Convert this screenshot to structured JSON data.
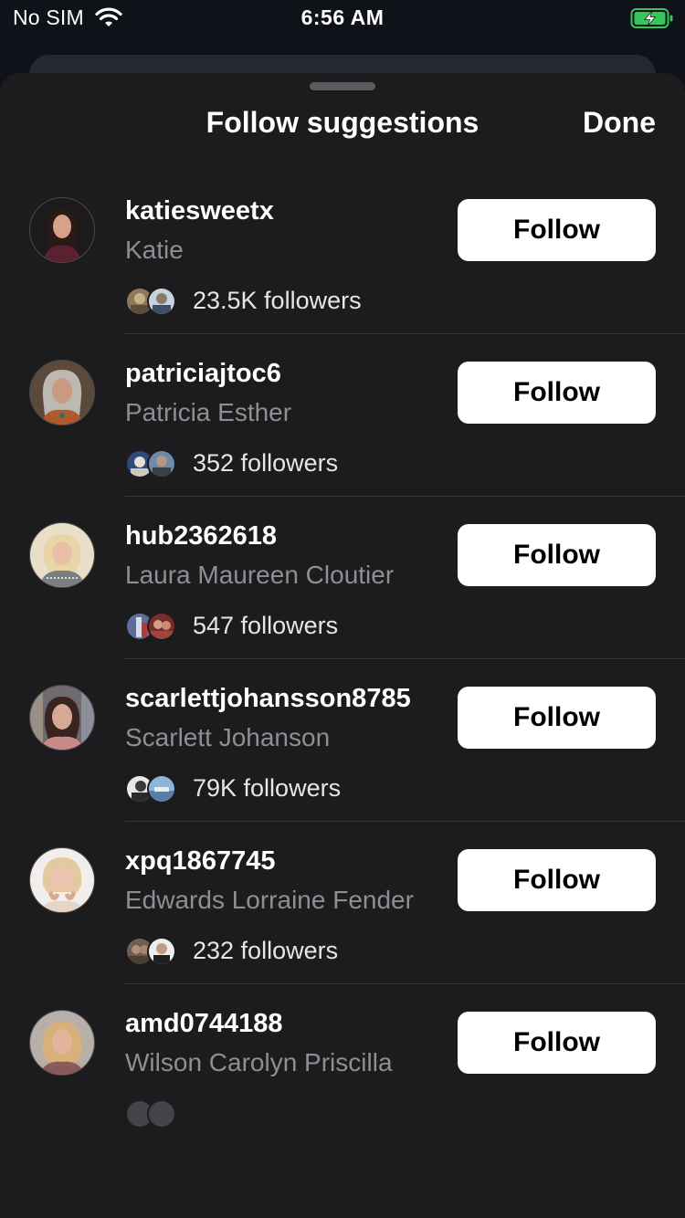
{
  "status_bar": {
    "carrier": "No SIM",
    "time": "6:56 AM",
    "battery_color": "#34c759"
  },
  "sheet": {
    "title": "Follow suggestions",
    "done_label": "Done"
  },
  "colors": {
    "sheet_background": "#1c1c1e",
    "secondary_text": "#8e8e93",
    "button_background": "#ffffff"
  },
  "suggestions": [
    {
      "username": "katiesweetx",
      "full_name": "Katie",
      "followers": "23.5K followers",
      "follow_label": "Follow",
      "avatar_tone": "#4a2b2e",
      "mutual_tones": [
        "#8a7a5a",
        "#6a7d94"
      ]
    },
    {
      "username": "patriciajtoc6",
      "full_name": "Patricia Esther",
      "followers": "352 followers",
      "follow_label": "Follow",
      "avatar_tone": "#8b6a55",
      "mutual_tones": [
        "#4d6a8c",
        "#5a6f85"
      ]
    },
    {
      "username": "hub2362618",
      "full_name": "Laura Maureen Cloutier",
      "followers": "547 followers",
      "follow_label": "Follow",
      "avatar_tone": "#d9c7a6",
      "mutual_tones": [
        "#5d6e9a",
        "#a0453f"
      ]
    },
    {
      "username": "scarlettjohansson8785",
      "full_name": "Scarlett Johanson",
      "followers": "79K followers",
      "follow_label": "Follow",
      "avatar_tone": "#8f6a60",
      "mutual_tones": [
        "#6a6a6a",
        "#6f96c0"
      ]
    },
    {
      "username": "xpq1867745",
      "full_name": "Edwards Lorraine Fender",
      "followers": "232 followers",
      "follow_label": "Follow",
      "avatar_tone": "#d8c4b4",
      "mutual_tones": [
        "#6e5f4e",
        "#a9a9b0"
      ]
    },
    {
      "username": "amd0744188",
      "full_name": "Wilson Carolyn Priscilla",
      "followers": "",
      "follow_label": "Follow",
      "avatar_tone": "#b88e78",
      "mutual_tones": [
        "#444448",
        "#444448"
      ]
    }
  ]
}
